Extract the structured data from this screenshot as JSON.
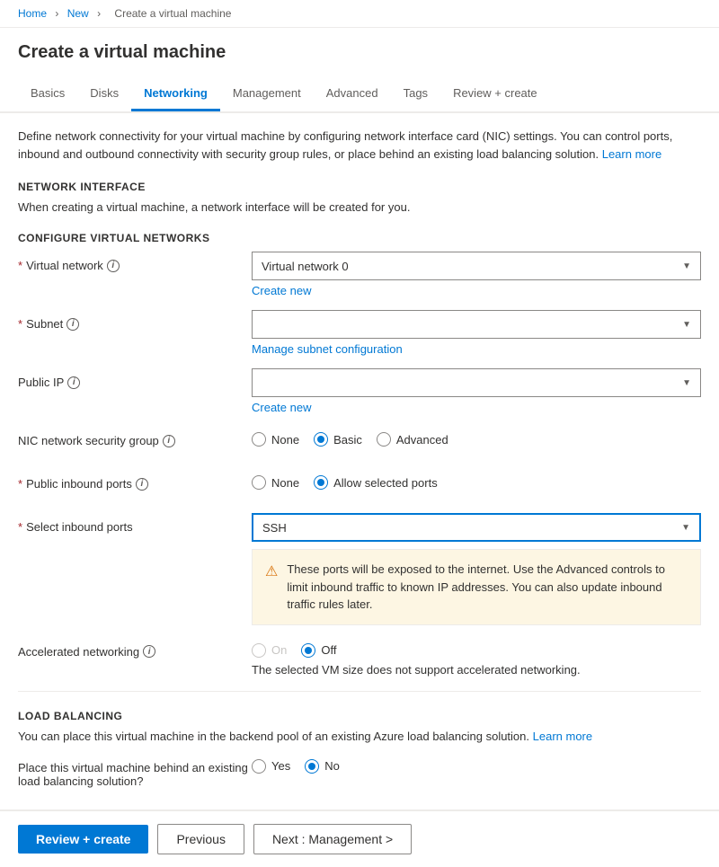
{
  "breadcrumb": {
    "items": [
      "Home",
      "New",
      "Create a virtual machine"
    ]
  },
  "page": {
    "title": "Create a virtual machine"
  },
  "tabs": [
    {
      "id": "basics",
      "label": "Basics",
      "active": false
    },
    {
      "id": "disks",
      "label": "Disks",
      "active": false
    },
    {
      "id": "networking",
      "label": "Networking",
      "active": true
    },
    {
      "id": "management",
      "label": "Management",
      "active": false
    },
    {
      "id": "advanced",
      "label": "Advanced",
      "active": false
    },
    {
      "id": "tags",
      "label": "Tags",
      "active": false
    },
    {
      "id": "review",
      "label": "Review + create",
      "active": false
    }
  ],
  "networking": {
    "description": "Define network connectivity for your virtual machine by configuring network interface card (NIC) settings. You can control ports, inbound and outbound connectivity with security group rules, or place behind an existing load balancing solution.",
    "learn_more": "Learn more",
    "network_interface": {
      "header": "NETWORK INTERFACE",
      "description": "When creating a virtual machine, a network interface will be created for you."
    },
    "configure_vnets": {
      "header": "CONFIGURE VIRTUAL NETWORKS"
    },
    "fields": {
      "virtual_network": {
        "label": "Virtual network",
        "value": "Virtual network 0",
        "create_new": "Create new"
      },
      "subnet": {
        "label": "Subnet",
        "value": "",
        "manage_link": "Manage subnet configuration"
      },
      "public_ip": {
        "label": "Public IP",
        "value": "",
        "create_new": "Create new"
      },
      "nic_security_group": {
        "label": "NIC network security group",
        "options": [
          "None",
          "Basic",
          "Advanced"
        ],
        "selected": "Basic"
      },
      "public_inbound_ports": {
        "label": "Public inbound ports",
        "options": [
          "None",
          "Allow selected ports"
        ],
        "selected": "Allow selected ports"
      },
      "select_inbound_ports": {
        "label": "Select inbound ports",
        "value": "SSH"
      },
      "warning": "These ports will be exposed to the internet. Use the Advanced controls to limit inbound traffic to known IP addresses. You can also update inbound traffic rules later.",
      "accelerated_networking": {
        "label": "Accelerated networking",
        "options": [
          "On",
          "Off"
        ],
        "selected": "Off",
        "note": "The selected VM size does not support accelerated networking."
      }
    },
    "load_balancing": {
      "header": "LOAD BALANCING",
      "description": "You can place this virtual machine in the backend pool of an existing Azure load balancing solution.",
      "learn_more": "Learn more",
      "place_behind": {
        "label": "Place this virtual machine behind an existing load balancing solution?",
        "options": [
          "Yes",
          "No"
        ],
        "selected": "No"
      }
    }
  },
  "footer": {
    "review_create": "Review + create",
    "previous": "Previous",
    "next": "Next : Management >"
  }
}
